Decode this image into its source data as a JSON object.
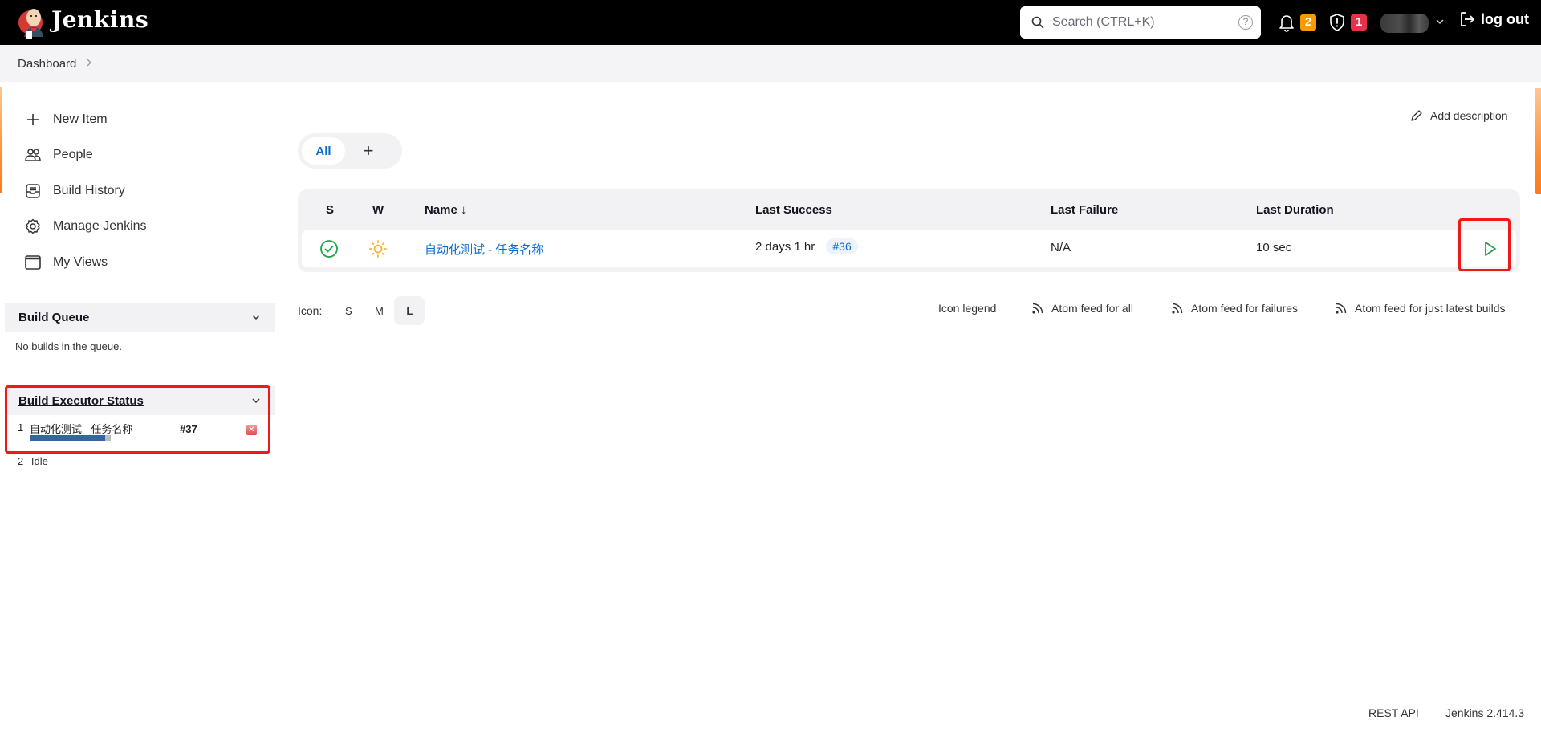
{
  "header": {
    "brand": "Jenkins",
    "search_placeholder": "Search (CTRL+K)",
    "help_glyph": "?",
    "notifications_count": "2",
    "security_count": "1",
    "logout_label": "log out",
    "colors": {
      "notifications_badge": "#fe9a00",
      "security_badge": "#e5334a"
    }
  },
  "breadcrumb": {
    "items": [
      "Dashboard"
    ],
    "separator": ">"
  },
  "sidebar": {
    "tasks": [
      {
        "label": "New Item",
        "icon": "plus-icon"
      },
      {
        "label": "People",
        "icon": "people-icon"
      },
      {
        "label": "Build History",
        "icon": "inbox-icon"
      },
      {
        "label": "Manage Jenkins",
        "icon": "gear-icon"
      },
      {
        "label": "My Views",
        "icon": "window-icon"
      }
    ],
    "build_queue": {
      "title": "Build Queue",
      "empty_text": "No builds in the queue."
    },
    "executors": {
      "title": "Build Executor Status",
      "rows": [
        {
          "number": "1",
          "job": "自动化测试 - 任务名称",
          "build": "#37",
          "progress": 0.93,
          "stop_glyph": "✕"
        },
        {
          "number": "2",
          "status": "Idle"
        }
      ]
    }
  },
  "main": {
    "add_description": "Add description",
    "tabs": [
      {
        "label": "All",
        "active": true
      },
      {
        "label": "+"
      }
    ],
    "table": {
      "columns": [
        "S",
        "W",
        "Name ↓",
        "Last Success",
        "Last Failure",
        "Last Duration"
      ],
      "rows": [
        {
          "status": "success",
          "weather": "sunny",
          "name": "自动化测试 - 任务名称",
          "last_success": "2 days 1 hr",
          "last_success_build": "#36",
          "last_failure": "N/A",
          "last_duration": "10 sec"
        }
      ]
    },
    "icon_size": {
      "label": "Icon:",
      "options": [
        "S",
        "M",
        "L"
      ],
      "selected": "L"
    },
    "links": {
      "icon_legend": "Icon legend",
      "feed_all": "Atom feed for all",
      "feed_failures": "Atom feed for failures",
      "feed_latest": "Atom feed for just latest builds"
    }
  },
  "footer": {
    "rest_api": "REST API",
    "version": "Jenkins 2.414.3"
  }
}
